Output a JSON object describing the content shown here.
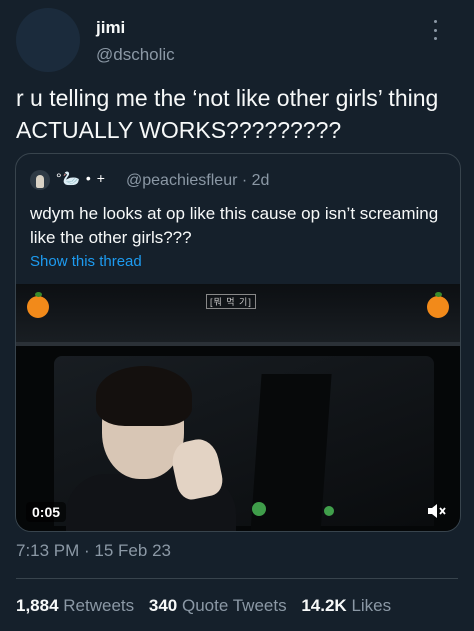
{
  "author": {
    "name": "jimi",
    "handle": "@dscholic"
  },
  "tweet": {
    "text": "r u telling me the ‘not like other girls’ thing ACTUALLY WORKS?????????"
  },
  "quote": {
    "emoji": "°🦢 • +",
    "handle_time": "@peachiesfleur · 2d",
    "text": "wdym he looks at op like this cause op isn’t screaming like the other girls???",
    "show_thread": "Show this thread",
    "video": {
      "duration": "0:05",
      "sign_text": "[뭐 먹 기]"
    }
  },
  "timestamp": "7:13 PM · 15 Feb 23",
  "stats": {
    "retweets": {
      "count": "1,884",
      "label": "Retweets"
    },
    "quotes": {
      "count": "340",
      "label": "Quote Tweets"
    },
    "likes": {
      "count": "14.2K",
      "label": "Likes"
    }
  },
  "colors": {
    "background": "#15202b",
    "text": "#f7f9f9",
    "secondary": "#8b98a5",
    "link": "#1d9bf0"
  }
}
